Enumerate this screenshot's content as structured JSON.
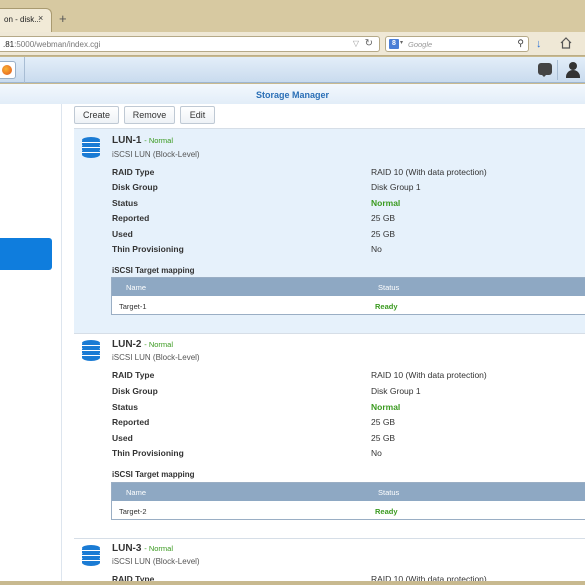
{
  "browser": {
    "tab_title": "on - disk...",
    "tab_close": "×",
    "new_tab": "+",
    "url_prefix": ".81",
    "url_rest": ":5000/webman/index.cgi",
    "search_placeholder": "Google",
    "search_engine_letter": "8"
  },
  "window": {
    "title": "Storage Manager"
  },
  "toolbar": {
    "create": "Create",
    "remove": "Remove",
    "edit": "Edit"
  },
  "labels": {
    "raid_type": "RAID Type",
    "disk_group": "Disk Group",
    "status": "Status",
    "reported": "Reported",
    "used": "Used",
    "thin": "Thin Provisioning",
    "mapping": "iSCSI Target mapping",
    "col_name": "Name",
    "col_status": "Status"
  },
  "luns": [
    {
      "name": "LUN-1",
      "state": "- Normal",
      "type": "iSCSI LUN (Block-Level)",
      "raid_type": "RAID 10 (With data protection)",
      "disk_group": "Disk Group 1",
      "status": "Normal",
      "reported": "25 GB",
      "used": "25 GB",
      "thin": "No",
      "target": "Target-1",
      "target_status": "Ready"
    },
    {
      "name": "LUN-2",
      "state": "- Normal",
      "type": "iSCSI LUN (Block-Level)",
      "raid_type": "RAID 10 (With data protection)",
      "disk_group": "Disk Group 1",
      "status": "Normal",
      "reported": "25 GB",
      "used": "25 GB",
      "thin": "No",
      "target": "Target-2",
      "target_status": "Ready"
    },
    {
      "name": "LUN-3",
      "state": "- Normal",
      "type": "iSCSI LUN (Block-Level)",
      "raid_type": "RAID 10 (With data protection)"
    }
  ],
  "colors": {
    "accent": "#0f7ddd",
    "status_green": "#3a9a1f",
    "title_blue": "#2a6fb6"
  }
}
